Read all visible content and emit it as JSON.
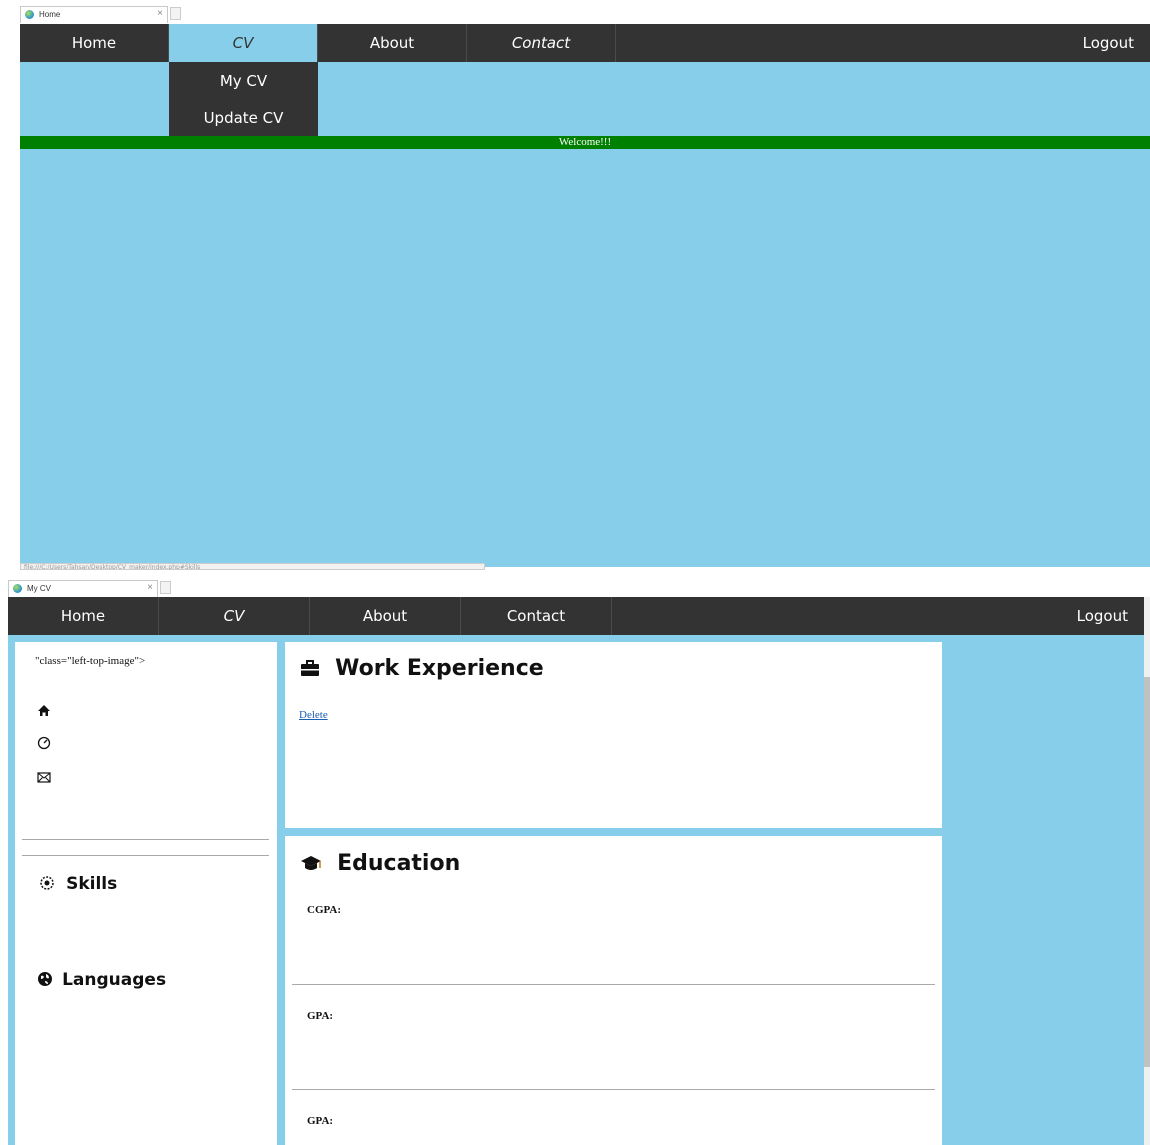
{
  "home_window": {
    "tab": {
      "title": "Home",
      "close": "×"
    },
    "nav": {
      "home": "Home",
      "cv": "CV",
      "about": "About",
      "contact": "Contact",
      "logout": "Logout"
    },
    "dropdown": {
      "my_cv": "My CV",
      "update_cv": "Update CV"
    },
    "welcome": "Welcome!!!",
    "status_url": "file:///C:/Users/Tahsan/Desktop/CV_maker/index.php#Skills"
  },
  "cv_window": {
    "tab": {
      "title": "My CV",
      "close": "×"
    },
    "nav": {
      "home": "Home",
      "cv": "CV",
      "about": "About",
      "contact": "Contact",
      "logout": "Logout"
    },
    "sidebar": {
      "image_text": "\"class=\"left-top-image\">",
      "skills_title": "Skills",
      "languages_title": "Languages"
    },
    "work": {
      "title": "Work Experience",
      "delete_link": "Delete"
    },
    "education": {
      "title": "Education",
      "labels": [
        "CGPA:",
        "GPA:",
        "GPA:"
      ]
    }
  },
  "colors": {
    "nav_bg": "#333333",
    "page_bg": "#87ceeb",
    "welcome_bg": "#008000",
    "panel_bg": "#ffffff",
    "link": "#1a5fb4"
  },
  "icons": [
    "home-icon",
    "dashboard-icon",
    "envelope-icon",
    "gear-icon",
    "globe-icon",
    "briefcase-icon",
    "graduation-cap-icon"
  ]
}
